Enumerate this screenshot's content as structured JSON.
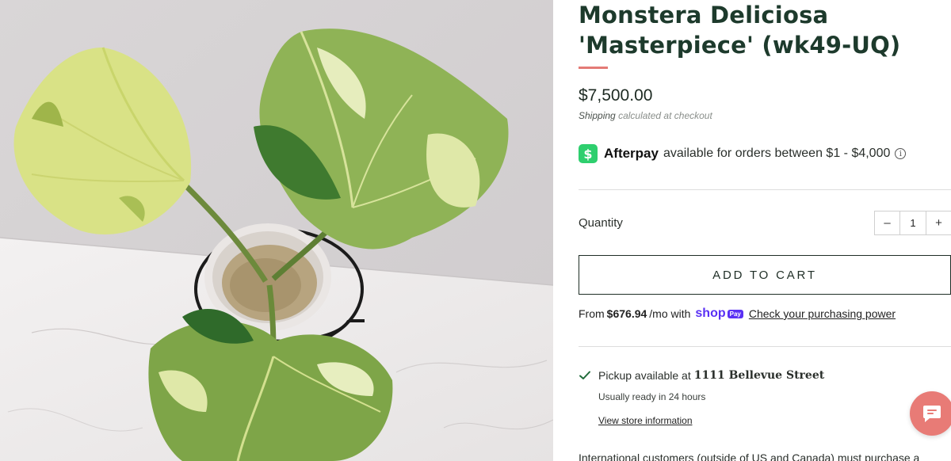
{
  "product": {
    "image_alt": "Monstera Deliciosa 'Masterpiece' plant in white pot on black metal stand",
    "title": "Monstera Deliciosa 'Masterpiece' (wk49-UQ)",
    "price": "$7,500.00",
    "shipping_label": "Shipping",
    "shipping_note": "calculated at checkout"
  },
  "afterpay": {
    "icon": "afterpay-dollar-icon",
    "badge_glyph": "$",
    "brand": "Afterpay",
    "text": "available for orders between $1 - $4,000",
    "info_glyph": "i"
  },
  "quantity": {
    "label": "Quantity",
    "decrement": "–",
    "value": "1",
    "increment": "+"
  },
  "cart": {
    "add_label": "ADD TO CART"
  },
  "shop_pay": {
    "prefix": "From",
    "amount": "$676.94",
    "suffix": "/mo with",
    "shop_word": "shop",
    "pay_word": "Pay",
    "link": "Check your purchasing power"
  },
  "pickup": {
    "prefix": "Pickup available at",
    "location": "1111 Bellevue Street",
    "ready": "Usually ready in 24 hours",
    "store_link": "View store information"
  },
  "intl_note": "International customers (outside of US and Canada) must purchase a",
  "colors": {
    "title": "#1d3a2c",
    "accent_rule": "#e47a76",
    "afterpay_green": "#2ecf6e",
    "shop_pay_purple": "#5a31f4",
    "pickup_check": "#1f6b3a",
    "chat_button": "#e87b76"
  },
  "chat": {
    "icon": "chat-bubble-icon"
  }
}
